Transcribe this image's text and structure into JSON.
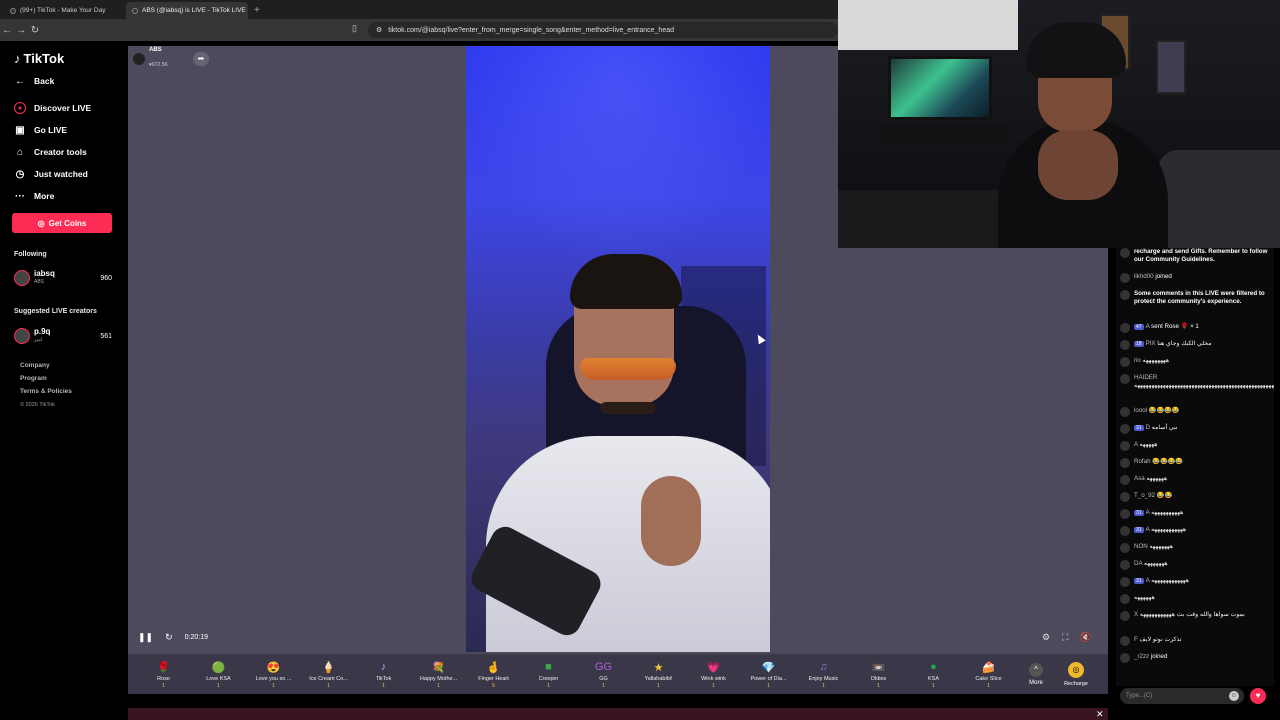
{
  "browser": {
    "tabs": [
      {
        "title": "(99+) TikTok - Make Your Day",
        "active": false
      },
      {
        "title": "ABS (@iabsq) is LIVE - TikTok LIVE",
        "active": true
      }
    ],
    "url": "tiktok.com/@iabsq/live?enter_from_merge=single_song&enter_method=live_entrance_head"
  },
  "sidebar": {
    "logo": "TikTok",
    "back": "Back",
    "items": [
      {
        "label": "Discover LIVE",
        "icon": "live-icon"
      },
      {
        "label": "Go LIVE",
        "icon": "camera-icon"
      },
      {
        "label": "Creator tools",
        "icon": "home-icon"
      },
      {
        "label": "Just watched",
        "icon": "history-icon"
      },
      {
        "label": "More",
        "icon": "more-icon"
      }
    ],
    "coins": "Get Coins",
    "following_title": "Following",
    "following": [
      {
        "name": "iabsq",
        "sub": "ABS",
        "count": "960"
      }
    ],
    "suggested_title": "Suggested LIVE creators",
    "suggested": [
      {
        "name": "p.9q",
        "sub": "امير",
        "count": "561"
      }
    ],
    "footer": [
      "Company",
      "Program",
      "Terms & Policies"
    ],
    "copyright": "© 2026 TikTok"
  },
  "player": {
    "host_name": "ABS",
    "host_likes": "672.5K",
    "time": "0:20:19"
  },
  "gifts": [
    {
      "name": "Rose",
      "price": "1",
      "icon": "🌹",
      "color": "#d7263d"
    },
    {
      "name": "Love KSA",
      "price": "1",
      "icon": "🟢",
      "color": "#1d8f4a"
    },
    {
      "name": "Love you so ...",
      "price": "1",
      "icon": "😍",
      "color": "#e96c2b"
    },
    {
      "name": "Ice Cream Co...",
      "price": "1",
      "icon": "🍦",
      "color": "#f7a8c4"
    },
    {
      "name": "TikTok",
      "price": "1",
      "icon": "♪",
      "color": "#c9a0ff"
    },
    {
      "name": "Happy Mothe...",
      "price": "1",
      "icon": "💐",
      "color": "#f7b0c7"
    },
    {
      "name": "Finger Heart",
      "price": "5",
      "icon": "🤞",
      "color": "#f08a6c"
    },
    {
      "name": "Creeper",
      "price": "1",
      "icon": "■",
      "color": "#3ba843"
    },
    {
      "name": "GG",
      "price": "1",
      "icon": "GG",
      "color": "#b05fd6"
    },
    {
      "name": "Yallahabibi!",
      "price": "1",
      "icon": "★",
      "color": "#f2c43d"
    },
    {
      "name": "Wink wink",
      "price": "1",
      "icon": "💗",
      "color": "#e75d9c"
    },
    {
      "name": "Power of Dia...",
      "price": "1",
      "icon": "💎",
      "color": "#f2c66a"
    },
    {
      "name": "Enjoy Music",
      "price": "1",
      "icon": "♫",
      "color": "#7d7df0"
    },
    {
      "name": "Oldies",
      "price": "1",
      "icon": "📼",
      "color": "#8a5de0"
    },
    {
      "name": "KSA",
      "price": "1",
      "icon": "●",
      "color": "#1fa84a"
    },
    {
      "name": "Cake Slice",
      "price": "1",
      "icon": "🍰",
      "color": "#f4c59c"
    }
  ],
  "more_label": "More",
  "recharge_label": "Recharge",
  "chat": {
    "messages": [
      {
        "user": "",
        "text": "recharge and send Gifts. Remember to follow our Community Guidelines.",
        "sys": true
      },
      {
        "user": "likhd00",
        "text": "joined"
      },
      {
        "user": "",
        "text": "Some comments in this LIVE were filtered to protect the community's experience.",
        "sys": true
      },
      {
        "user": "A",
        "lv": "47",
        "text": "sent Rose 🌹 × 1"
      },
      {
        "user": "PIX",
        "lv": "18",
        "text": "مخلي الكيك وجاي هنا"
      },
      {
        "user": "rio",
        "text": "ههههههههه"
      },
      {
        "user": "HAIDER",
        "text": "هههههههههههههههههههههههههههههههههههههههههههههههههههههههههههههههه"
      },
      {
        "user": "loool",
        "text": "😂😂😂😂"
      },
      {
        "user": "D",
        "lv": "31",
        "text": "نبي أسامه"
      },
      {
        "user": "A",
        "text": "هههههه"
      },
      {
        "user": "Rofah",
        "text": "😂😂😂😂"
      },
      {
        "user": "Asa",
        "text": "ههههههه"
      },
      {
        "user": "T_o_92",
        "text": "😂😂"
      },
      {
        "user": "A",
        "lv": "31",
        "text": "ههههههههههه"
      },
      {
        "user": "A",
        "lv": "31",
        "text": "هههههههههههه"
      },
      {
        "user": "NON",
        "text": "هههههههه"
      },
      {
        "user": "DA",
        "text": "هههههههه"
      },
      {
        "user": "A",
        "lv": "31",
        "text": "ههههههههههههه"
      },
      {
        "user": "",
        "text": "ههههههه"
      },
      {
        "user": "X",
        "text": "بموت سواها والله وقت بث هههههههههههه"
      },
      {
        "user": "F",
        "text": "تذكرت نوتو لايف"
      },
      {
        "user": "_r2zz",
        "text": "joined"
      }
    ],
    "input_placeholder": "Type...(C)"
  }
}
